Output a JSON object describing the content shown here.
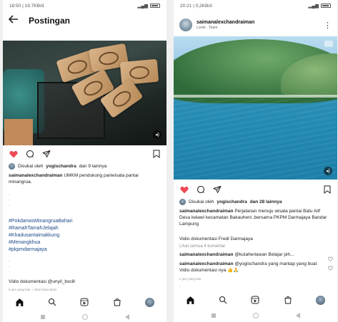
{
  "left": {
    "status": {
      "time": "18:50",
      "info": "19,7KB/d"
    },
    "header": {
      "title": "Postingan"
    },
    "liked_by": {
      "prefix": "Disukai oleh",
      "user": "yogischandra",
      "rest": "dan 9 lainnya"
    },
    "caption": {
      "username": "saimanalexchandraiman",
      "text": "UMKM pendukung pariwisata pantai minangrua."
    },
    "hashtags": [
      "#PokdarwisMinangruaBahari",
      "#RamahTamahJelajah",
      "#Khadusantaimakkung",
      "#Menangkhua",
      "#pkpmdarmajaya"
    ],
    "footer_text": "Vidio dokumentasi @unyil_bxcill",
    "time_note": "5 jam yang lalu · Lihat terjemahan"
  },
  "right": {
    "status": {
      "time": "20:21",
      "info": "0,2KB/d"
    },
    "post_header": {
      "username": "saimanalexchandraiman",
      "subtitle": "Lorde · Team"
    },
    "liked_by": {
      "prefix": "Disukai oleh",
      "user": "yogischandra",
      "rest": "dan 28 lainnya"
    },
    "caption": {
      "username": "saimanalexchandraiman",
      "text": "Perjalanan menuju wisata pantai Batu Alif Desa kelawi kecamatan Bakauheni ,bersama PKPM Darmajaya Bandar Lampung"
    },
    "doc_text": "Vidio dokumentasi Fredi Darmajaya",
    "view_comments": "Lihat semua 4 komentar",
    "comments": [
      {
        "username": "saimanalexchandraiman",
        "text": "@kutaheriawan Belajar pih..."
      },
      {
        "username": "saimanalexchandraiman",
        "text": "@yogischandra yang mantap yang buat Vidio dokumentasi nya 👍🙏"
      }
    ],
    "time_note": "2 jam yang lalu"
  },
  "colors": {
    "like_red": "#ed4956",
    "hashtag_blue": "#1e4a8a"
  },
  "icons": [
    "back-arrow-icon",
    "heart-icon",
    "comment-icon",
    "share-icon",
    "bookmark-icon",
    "home-icon",
    "search-icon",
    "reels-icon",
    "shop-icon",
    "profile-avatar-icon",
    "mute-icon",
    "more-options-icon"
  ]
}
